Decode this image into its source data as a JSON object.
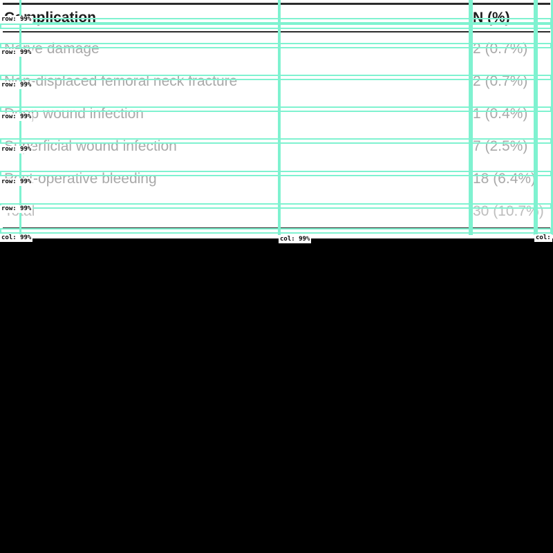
{
  "table": {
    "header": {
      "label": "Complication",
      "value": "N (%)"
    },
    "rows": [
      {
        "label": "Nerve damage",
        "value": "2 (0.7%)"
      },
      {
        "label": "Non-displaced femoral neck fracture",
        "value": "2 (0.7%)"
      },
      {
        "label": "Deep wound infection",
        "value": "1 (0.4%)"
      },
      {
        "label": "Superficial wound infection",
        "value": "7 (2.5%)"
      },
      {
        "label": "Post-operative bleeding",
        "value": "18 (6.4%)"
      }
    ],
    "total": {
      "label": "Total",
      "value": "30 (10.7%)"
    }
  },
  "overlay": {
    "row_tags": [
      "row: 99%",
      "row: 99%",
      "row: 99%",
      "row: 99%",
      "row: 99%",
      "row: 99%",
      "row: 99%"
    ],
    "col_tags": [
      "col: 99%",
      "col: 99%",
      "col:"
    ],
    "box_color": "#7ff2d0"
  }
}
